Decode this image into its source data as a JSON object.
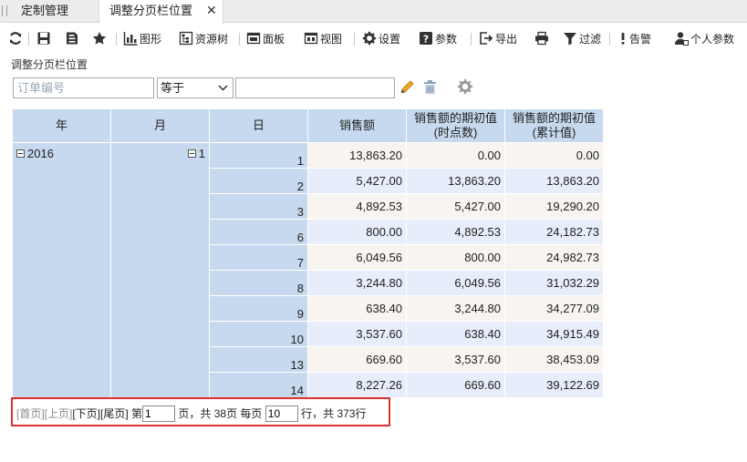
{
  "tabs": [
    {
      "label": "定制管理"
    },
    {
      "label": "调整分页栏位置"
    }
  ],
  "toolbar": {
    "graph": "图形",
    "resource_tree": "资源树",
    "panel": "面板",
    "view": "视图",
    "settings": "设置",
    "params": "参数",
    "export": "导出",
    "filter": "过滤",
    "alert": "告警",
    "personal_params": "个人参数"
  },
  "subtitle": "调整分页栏位置",
  "filter": {
    "field_placeholder": "订单编号",
    "operator": "等于",
    "value": ""
  },
  "table": {
    "headers": {
      "year": "年",
      "month": "月",
      "day": "日",
      "sales": "销售额",
      "initial_point": "销售额的期初值\n(时点数)",
      "initial_cumulative": "销售额的期初值\n(累计值)"
    },
    "year": "2016",
    "month": "1",
    "rows": [
      {
        "day": "1",
        "sales": "13,863.20",
        "point": "0.00",
        "cum": "0.00"
      },
      {
        "day": "2",
        "sales": "5,427.00",
        "point": "13,863.20",
        "cum": "13,863.20"
      },
      {
        "day": "3",
        "sales": "4,892.53",
        "point": "5,427.00",
        "cum": "19,290.20"
      },
      {
        "day": "6",
        "sales": "800.00",
        "point": "4,892.53",
        "cum": "24,182.73"
      },
      {
        "day": "7",
        "sales": "6,049.56",
        "point": "800.00",
        "cum": "24,982.73"
      },
      {
        "day": "8",
        "sales": "3,244.80",
        "point": "6,049.56",
        "cum": "31,032.29"
      },
      {
        "day": "9",
        "sales": "638.40",
        "point": "3,244.80",
        "cum": "34,277.09"
      },
      {
        "day": "10",
        "sales": "3,537.60",
        "point": "638.40",
        "cum": "34,915.49"
      },
      {
        "day": "13",
        "sales": "669.60",
        "point": "3,537.60",
        "cum": "38,453.09"
      },
      {
        "day": "14",
        "sales": "8,227.26",
        "point": "669.60",
        "cum": "39,122.69"
      }
    ]
  },
  "pager": {
    "first": "[首页]",
    "prev": "[上页]",
    "next": "[下页]",
    "last": "[尾页]",
    "page_prefix": "第",
    "page_value": "1",
    "page_suffix": "页，共 38页 每页",
    "per_page_value": "10",
    "rows_suffix": "行，共 373行"
  },
  "colors": {
    "header_bg": "#c6d9ee",
    "row_odd": "#f8f5f0",
    "row_even": "#e7edfa",
    "highlight_border": "#e03131"
  },
  "icons": [
    "refresh-icon",
    "save-icon",
    "save-as-icon",
    "star-icon",
    "chart-icon",
    "tree-icon",
    "panel-icon",
    "view-icon",
    "gear-icon",
    "help-icon",
    "export-icon",
    "print-icon",
    "filter-icon",
    "alert-icon",
    "user-icon",
    "pencil-icon",
    "trash-icon",
    "settings-icon",
    "close-icon"
  ]
}
